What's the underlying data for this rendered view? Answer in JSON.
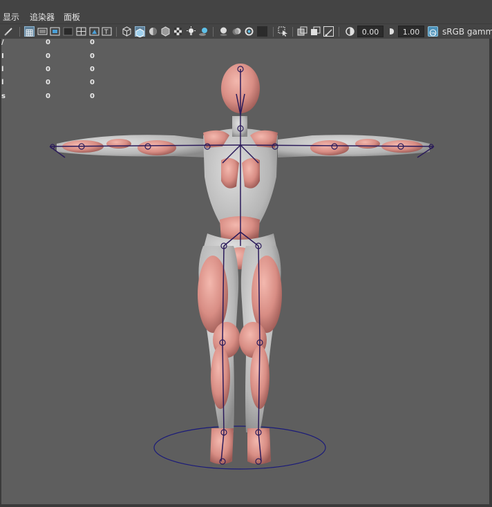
{
  "menubar": {
    "items": [
      "显示",
      "追染器",
      "面板"
    ]
  },
  "toolbar": {
    "field_exposure": "0.00",
    "field_gamma": "1.00",
    "color_space_label": "sRGB gamm",
    "icons": [
      "brush-icon",
      "grid-icon",
      "film-gate-icon",
      "resolution-gate-icon",
      "gate-mask-icon",
      "field-chart-icon",
      "safe-action-icon",
      "safe-title-icon",
      "wireframe-cube-icon",
      "smooth-shade-icon",
      "default-material-icon",
      "textured-icon",
      "checker-icon",
      "lights-icon",
      "shadows-icon",
      "ambient-occlusion-icon",
      "motion-blur-icon",
      "antialias-icon",
      "depth-of-field-icon",
      "isolate-select-icon",
      "xray-icon",
      "xray-active-icon",
      "xray-joints-icon",
      "exposure-icon",
      "gamma-icon",
      "color-management-icon"
    ]
  },
  "hud": {
    "rows": [
      {
        "mark": "/",
        "a": "0",
        "b": "0"
      },
      {
        "mark": "I",
        "a": "0",
        "b": "0"
      },
      {
        "mark": "l",
        "a": "0",
        "b": "0"
      },
      {
        "mark": "l",
        "a": "0",
        "b": "0"
      },
      {
        "mark": "s",
        "a": "0",
        "b": "0"
      }
    ]
  },
  "scene": {
    "mesh_color": "#d99088",
    "mesh_grey": "#bfbfbf",
    "joint_color": "#2a1a5a",
    "ground_circle_color": "#1a1a7a",
    "background": "#5e5e5e"
  }
}
